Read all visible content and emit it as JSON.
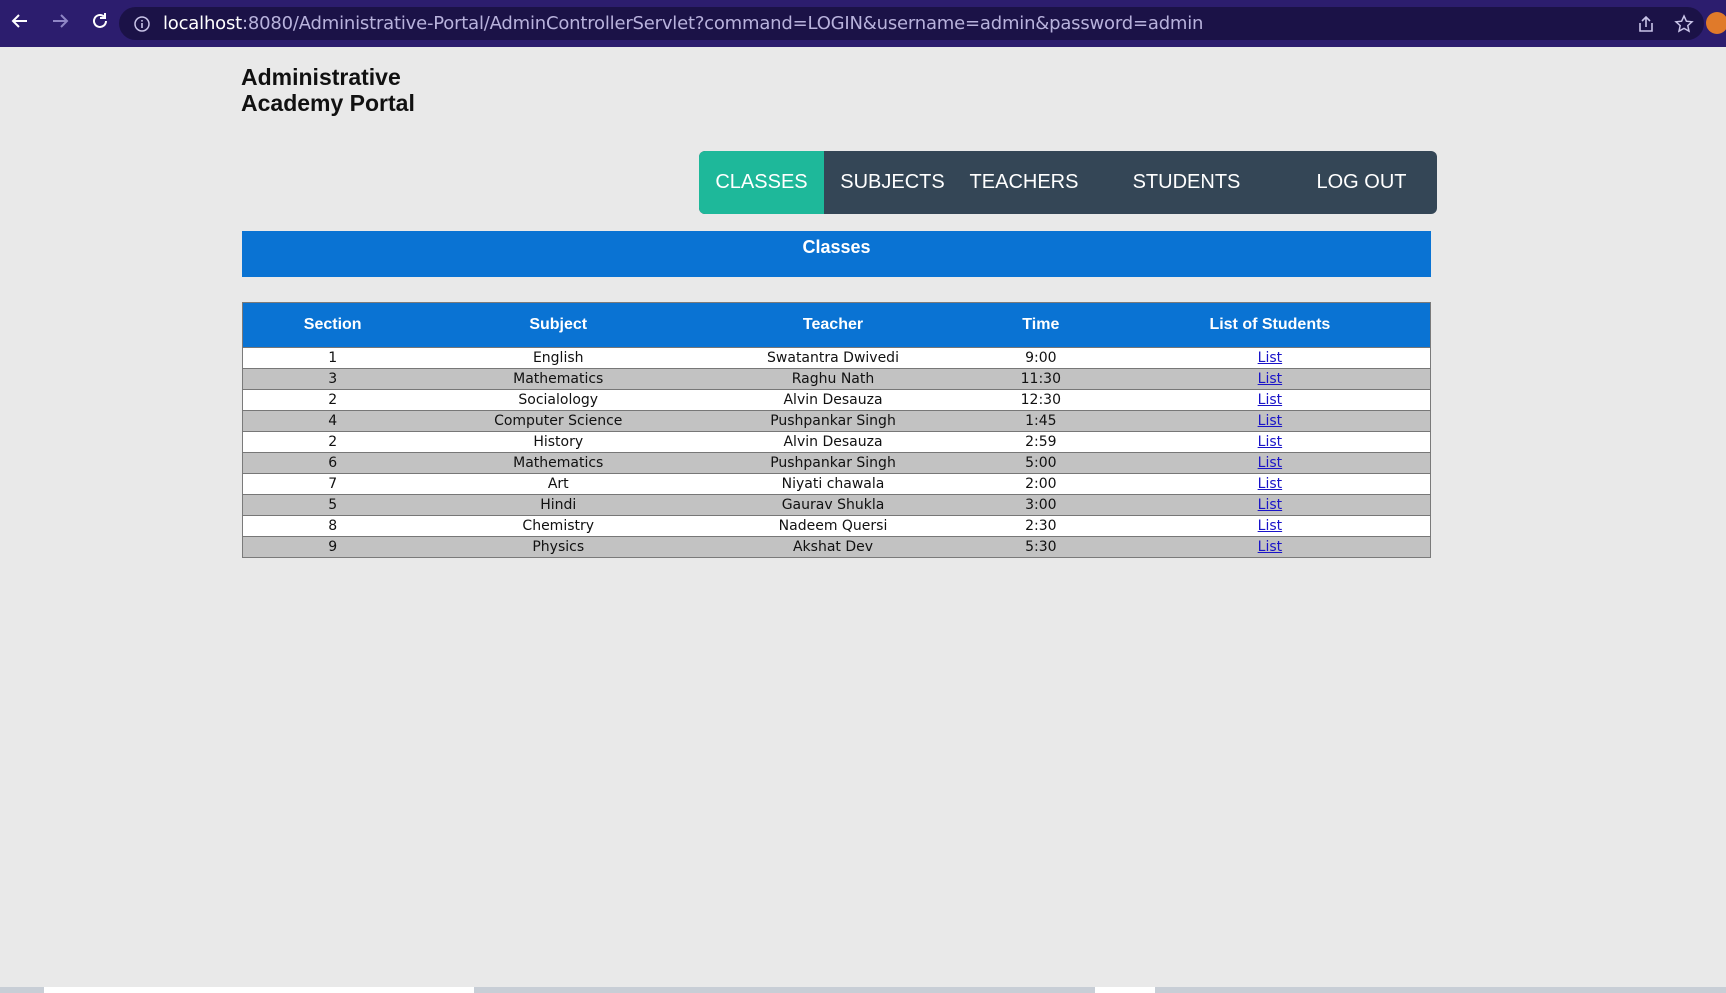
{
  "browser": {
    "url_host": "localhost",
    "url_rest": ":8080/Administrative-Portal/AdminControllerServlet?command=LOGIN&username=admin&password=admin",
    "icons": [
      "back-arrow-icon",
      "forward-arrow-icon",
      "reload-icon",
      "info-icon",
      "share-icon",
      "star-icon"
    ]
  },
  "site": {
    "title_line1": "Administrative",
    "title_line2": "Academy Portal"
  },
  "menu": {
    "items": [
      {
        "label": "CLASSES",
        "active": true
      },
      {
        "label": "SUBJECTS"
      },
      {
        "label": "TEACHERS"
      },
      {
        "label": "STUDENTS"
      },
      {
        "label": "LOG OUT"
      }
    ]
  },
  "banner": {
    "title": "Classes"
  },
  "table": {
    "headers": [
      "Section",
      "Subject",
      "Teacher",
      "Time",
      "List of Students"
    ],
    "rows": [
      [
        "1",
        "English",
        "Swatantra Dwivedi",
        "9:00",
        "List"
      ],
      [
        "3",
        "Mathematics",
        "Raghu Nath",
        "11:30",
        "List"
      ],
      [
        "2",
        "Socialology",
        "Alvin Desauza",
        "12:30",
        "List"
      ],
      [
        "4",
        "Computer Science",
        "Pushpankar Singh",
        "1:45",
        "List"
      ],
      [
        "2",
        "History",
        "Alvin Desauza",
        "2:59",
        "List"
      ],
      [
        "6",
        "Mathematics",
        "Pushpankar Singh",
        "5:00",
        "List"
      ],
      [
        "7",
        "Art",
        "Niyati chawala",
        "2:00",
        "List"
      ],
      [
        "5",
        "Hindi",
        "Gaurav Shukla",
        "3:00",
        "List"
      ],
      [
        "8",
        "Chemistry",
        "Nadeem Quersi",
        "2:30",
        "List"
      ],
      [
        "9",
        "Physics",
        "Akshat Dev",
        "5:30",
        "List"
      ]
    ]
  },
  "colors": {
    "browser_bar": "#2c1d6e",
    "menu_bg": "#344656",
    "menu_active": "#1eb89a",
    "header_blue": "#0a73d3",
    "row_alt": "#c2c2c2"
  }
}
